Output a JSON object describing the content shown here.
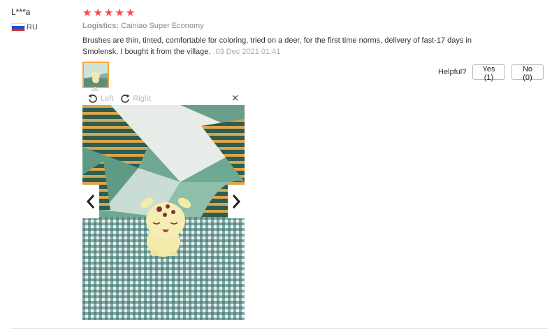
{
  "review": {
    "user": "L***a",
    "country": "RU",
    "rating": 5,
    "logistics_label": "Logistics:",
    "logistics_value": "Cainiao Super Economy",
    "text": "Brushes are thin, tinted, comfortable for coloring, tried on a deer, for the first time norms, delivery of fast-17 days in Smolensk, I bought it from the village.",
    "date": "03 Dec 2021 01:41"
  },
  "helpful": {
    "label": "Helpful?",
    "yes": "Yes (1)",
    "no": "No (0)"
  },
  "viewer": {
    "rotate_left": "Left",
    "rotate_right": "Right",
    "close": "×"
  },
  "colors": {
    "star": "#ff4747",
    "thumb_border": "#f9a43b"
  },
  "icons": {
    "close": "close-icon",
    "rotate_left": "rotate-left-icon",
    "rotate_right": "rotate-right-icon",
    "prev": "chevron-left-icon",
    "next": "chevron-right-icon"
  }
}
